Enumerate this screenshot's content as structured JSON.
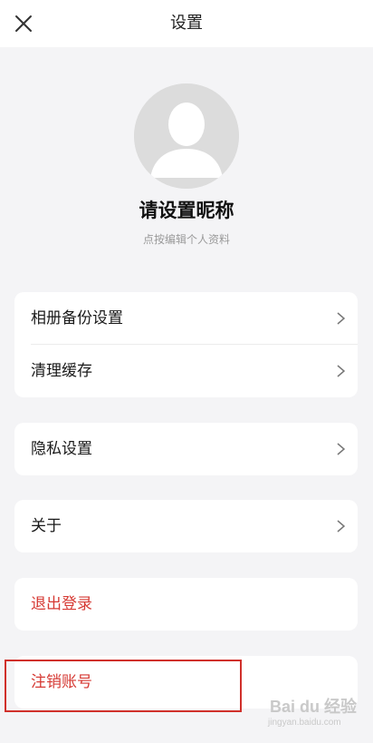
{
  "header": {
    "title": "设置",
    "close_icon": "close-icon"
  },
  "profile": {
    "nickname": "请设置昵称",
    "hint": "点按编辑个人资料",
    "avatar_icon": "default-avatar-icon"
  },
  "menu": {
    "album_backup": "相册备份设置",
    "clear_cache": "清理缓存",
    "privacy": "隐私设置",
    "about": "关于",
    "logout": "退出登录",
    "delete_account": "注销账号"
  },
  "colors": {
    "background": "#f4f4f6",
    "card": "#ffffff",
    "danger_text": "#d63a34",
    "annotation_border": "#d0302b"
  },
  "watermark": {
    "main": "Bai du 经验",
    "sub": "jingyan.baidu.com"
  }
}
